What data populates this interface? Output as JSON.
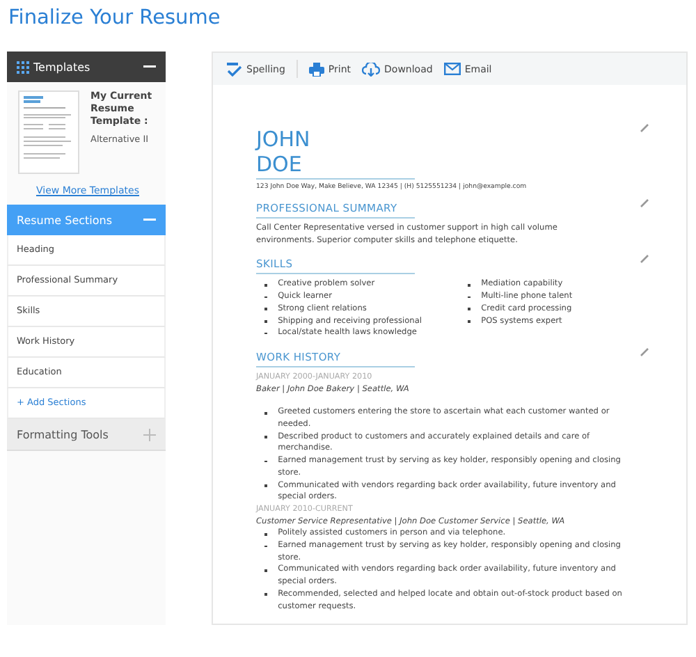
{
  "page_title": "Finalize Your Resume",
  "sidebar": {
    "templates_panel": {
      "title": "Templates",
      "expanded": true,
      "template_heading": "My Current Resume Template :",
      "template_name": "Alternative II",
      "link": "View More Templates"
    },
    "sections_panel": {
      "title": "Resume Sections",
      "expanded": true,
      "items": [
        "Heading",
        "Professional Summary",
        "Skills",
        "Work History",
        "Education"
      ],
      "add_link": "+ Add Sections"
    },
    "formatting_panel": {
      "title": "Formatting Tools",
      "expanded": false
    }
  },
  "toolbar": [
    {
      "kind": "spelling",
      "label": "Spelling"
    },
    {
      "kind": "print",
      "label": "Print"
    },
    {
      "kind": "download",
      "label": "Download"
    },
    {
      "kind": "email",
      "label": "Email"
    }
  ],
  "resume": {
    "first_name": "JOHN",
    "last_name": "DOE",
    "contact": "123 John Doe Way, Make Believe, WA 12345 | (H) 5125551234 | john@example.com",
    "summary_heading": "PROFESSIONAL SUMMARY",
    "summary": "Call Center Representative versed in customer support in high call volume environments. Superior computer skills and telephone etiquette.",
    "skills_heading": "SKILLS",
    "skills_left": [
      "Creative problem solver",
      "Quick learner",
      "Strong client relations",
      "Shipping and receiving professional",
      "Local/state health laws knowledge"
    ],
    "skills_right": [
      "Mediation capability",
      "Multi-line phone talent",
      "Credit card processing",
      "POS systems expert"
    ],
    "work_heading": "WORK HISTORY",
    "jobs": [
      {
        "dates": "JANUARY 2000-JANUARY 2010",
        "role": "Baker | John Doe Bakery | Seattle, WA",
        "gap": true,
        "bullets": [
          "Greeted customers entering the store to ascertain what each customer wanted or needed.",
          "Described product to customers and accurately explained details and care of merchandise.",
          "Earned management trust by serving as key holder, responsibly opening and closing store.",
          "Communicated with vendors regarding back order availability, future inventory and special orders."
        ]
      },
      {
        "dates": "JANUARY 2010-CURRENT",
        "role": "Customer Service Representative | John Doe Customer Service | Seattle, WA",
        "gap": false,
        "bullets": [
          "Politely assisted customers in person and via telephone.",
          "Earned management trust by serving as key holder, responsibly opening and closing store.",
          "Communicated with vendors regarding back order availability, future inventory and special orders.",
          "Recommended, selected and helped locate and obtain out-of-stock product based on customer requests."
        ]
      }
    ]
  }
}
